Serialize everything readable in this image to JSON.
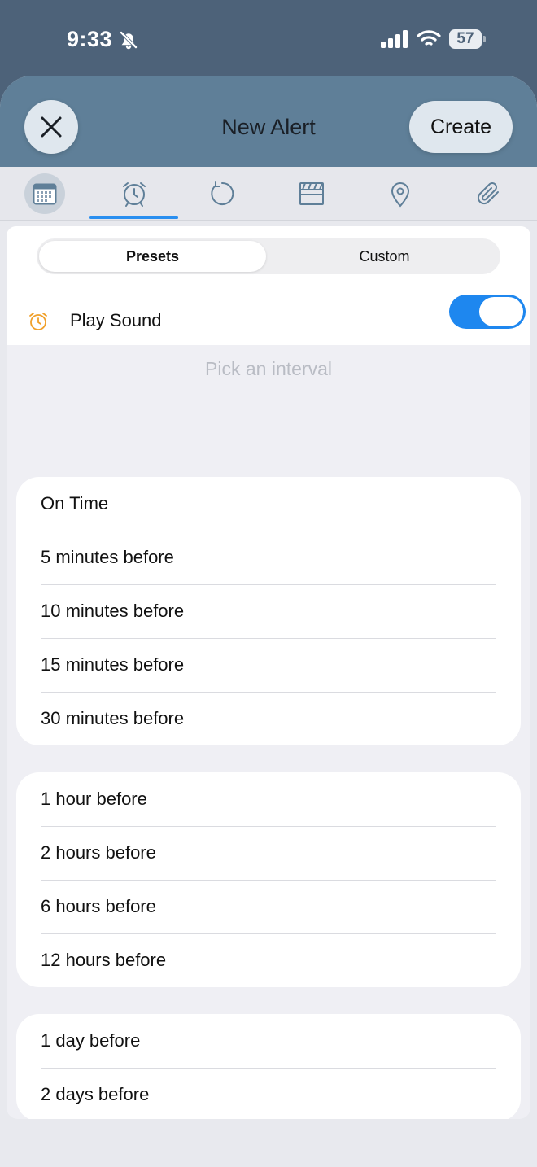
{
  "status_bar": {
    "time": "9:33",
    "battery": "57",
    "icons": [
      "bell-slash-icon",
      "cellular-signal-icon",
      "wifi-icon",
      "battery-icon"
    ]
  },
  "header": {
    "title": "New Alert",
    "create_label": "Create",
    "close_icon": "close-icon"
  },
  "tabs": [
    {
      "icon": "calendar-icon",
      "selected_bg": true
    },
    {
      "icon": "alarm-clock-icon",
      "active": true
    },
    {
      "icon": "repeat-icon"
    },
    {
      "icon": "clapperboard-icon"
    },
    {
      "icon": "location-pin-icon"
    },
    {
      "icon": "paperclip-icon"
    }
  ],
  "segmented": {
    "presets": "Presets",
    "custom": "Custom",
    "selected": "Presets"
  },
  "sound": {
    "label": "Play Sound",
    "enabled": true,
    "icon": "alarm-clock-icon"
  },
  "interval_label": "Pick an interval",
  "groups": [
    {
      "items": [
        "On Time",
        "5 minutes before",
        "10 minutes before",
        "15 minutes before",
        "30 minutes before"
      ]
    },
    {
      "items": [
        "1 hour before",
        "2 hours before",
        "6 hours before",
        "12 hours before"
      ]
    },
    {
      "items": [
        "1 day before",
        "2 days before"
      ]
    }
  ],
  "colors": {
    "accent": "#1e87ef",
    "header": "#5f7f98",
    "alarm_icon": "#f0a02a"
  }
}
